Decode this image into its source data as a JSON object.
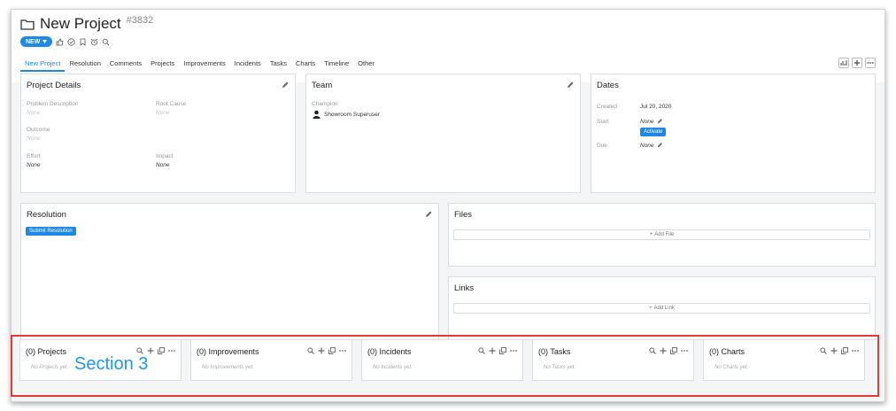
{
  "header": {
    "title": "New Project",
    "id": "#3832",
    "status": "NEW"
  },
  "tabs": [
    "New Project",
    "Resolution",
    "Comments",
    "Projects",
    "Improvements",
    "Incidents",
    "Tasks",
    "Charts",
    "Timeline",
    "Other"
  ],
  "project_details": {
    "title": "Project Details",
    "fields": [
      {
        "label": "Problem Description",
        "value": "None"
      },
      {
        "label": "Root Cause",
        "value": "None"
      },
      {
        "label": "Outcome",
        "value": "None"
      },
      {
        "label": "Effort",
        "value": "None"
      },
      {
        "label": "Impact",
        "value": "None"
      }
    ]
  },
  "team": {
    "title": "Team",
    "champion_label": "Champion",
    "champion_name": "Showroom Superuser"
  },
  "dates": {
    "title": "Dates",
    "created_label": "Created",
    "created_value": "Jul 20, 2020",
    "start_label": "Start",
    "start_value": "None",
    "activate_label": "Activate",
    "due_label": "Due",
    "due_value": "None"
  },
  "resolution": {
    "title": "Resolution",
    "submit_label": "Submit Resolution"
  },
  "files": {
    "title": "Files",
    "add_label": "Add File"
  },
  "links": {
    "title": "Links",
    "add_label": "Add Link"
  },
  "section3": {
    "label": "Section 3",
    "highlight_color": "#e53935",
    "panels": [
      {
        "title": "(0) Projects",
        "empty": "No Projects yet."
      },
      {
        "title": "(0) Improvements",
        "empty": "No Improvements yet."
      },
      {
        "title": "(0) Incidents",
        "empty": "No Incidents yet."
      },
      {
        "title": "(0) Tasks",
        "empty": "No Tasks yet."
      },
      {
        "title": "(0) Charts",
        "empty": "No Charts yet."
      }
    ]
  },
  "colors": {
    "accent": "#1e88e5",
    "background": "#f4f5f6"
  }
}
